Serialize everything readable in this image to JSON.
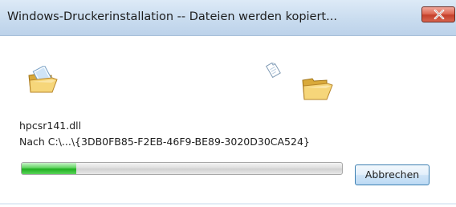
{
  "window": {
    "title": "Windows-Druckerinstallation -- Dateien werden kopiert...",
    "close_icon": "close-icon"
  },
  "copy": {
    "file_name": "hpcsr141.dll",
    "destination": "Nach C:\\...\\{3DB0FB85-F2EB-46F9-BE89-3020D30CA524}",
    "progress_fraction": 0.17
  },
  "buttons": {
    "cancel_label": "Abbrechen"
  },
  "icons": {
    "source_folder": "folder-icon",
    "flying_document": "document-icon",
    "target_folder": "folder-icon"
  },
  "colors": {
    "titlebar": "#c9dcef",
    "close_button": "#c4402b",
    "progress_fill": "#1fae1f",
    "cancel_border": "#3c7fb1"
  }
}
